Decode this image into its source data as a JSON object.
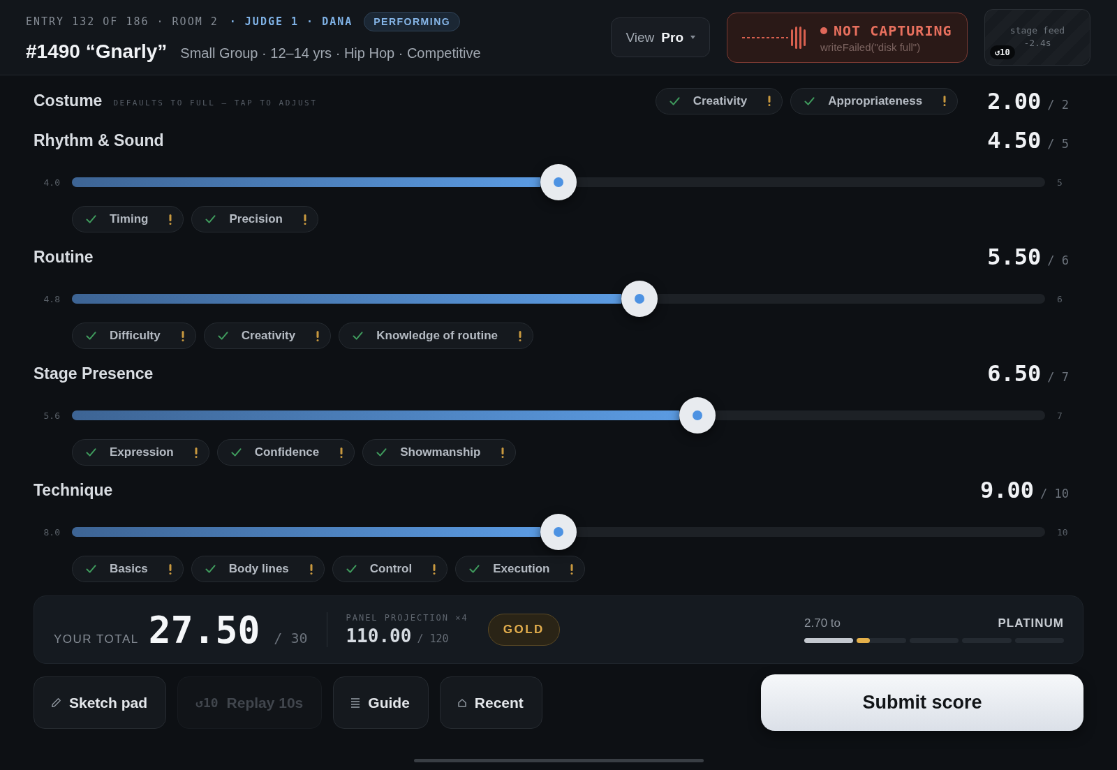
{
  "header": {
    "entry": "ENTRY 132 OF 186 · ROOM 2",
    "judge": "· JUDGE 1 · DANA",
    "status_badge": "PERFORMING",
    "routine_title": "#1490 “Gnarly”",
    "details": "Small Group · 12–14 yrs · Hip Hop · Competitive",
    "view_menu": {
      "label": "View",
      "value": "Pro"
    },
    "capture": {
      "capturing": false,
      "status": "NOT CAPTURING",
      "detail": "writeFailed(\"disk full\")"
    },
    "stage_feed": {
      "label": "stage feed",
      "delay": "-2.4s",
      "replay_badge": "↺10"
    }
  },
  "sections": [
    {
      "kind": "fixed",
      "title": "Costume",
      "hint": "DEFAULTS TO FULL — TAP TO ADJUST",
      "score": "2.00",
      "out_of": "/ 2",
      "criteria": [
        {
          "label": "Creativity",
          "checked": true
        },
        {
          "label": "Appropriateness",
          "checked": true
        }
      ]
    },
    {
      "kind": "slider",
      "title": "Rhythm & Sound",
      "score": "4.50",
      "out_of": "/ 5",
      "slider": {
        "min_label": "4.0",
        "max_label": "5",
        "level": 0.5
      },
      "criteria": [
        {
          "label": "Timing",
          "checked": true
        },
        {
          "label": "Precision",
          "checked": true
        }
      ]
    },
    {
      "kind": "slider",
      "title": "Routine",
      "score": "5.50",
      "out_of": "/ 6",
      "slider": {
        "min_label": "4.8",
        "max_label": "6",
        "level": 0.583
      },
      "criteria": [
        {
          "label": "Difficulty",
          "checked": true
        },
        {
          "label": "Creativity",
          "checked": true
        },
        {
          "label": "Knowledge of routine",
          "checked": true
        }
      ]
    },
    {
      "kind": "slider",
      "title": "Stage Presence",
      "score": "6.50",
      "out_of": "/ 7",
      "slider": {
        "min_label": "5.6",
        "max_label": "7",
        "level": 0.643
      },
      "criteria": [
        {
          "label": "Expression",
          "checked": true
        },
        {
          "label": "Confidence",
          "checked": true
        },
        {
          "label": "Showmanship",
          "checked": true
        }
      ]
    },
    {
      "kind": "slider",
      "title": "Technique",
      "score": "9.00",
      "out_of": "/ 10",
      "slider": {
        "min_label": "8.0",
        "max_label": "10",
        "level": 0.5
      },
      "criteria": [
        {
          "label": "Basics",
          "checked": true
        },
        {
          "label": "Body lines",
          "checked": true
        },
        {
          "label": "Control",
          "checked": true
        },
        {
          "label": "Execution",
          "checked": true
        }
      ]
    }
  ],
  "total": {
    "label": "YOUR TOTAL",
    "value": "27.50",
    "out_of": "/ 30",
    "projection": {
      "label": "PANEL PROJECTION ×4",
      "value": "110.00",
      "out_of": "/ 120"
    },
    "award": "GOLD",
    "next_tier": {
      "gap": "2.70 to",
      "name": "PLATINUM",
      "segments": [
        {
          "reached": true,
          "color": "#c3c8cf"
        },
        {
          "reached": false,
          "level": 0.26,
          "color": "#e4b04a"
        },
        {
          "reached": false
        },
        {
          "reached": false
        },
        {
          "reached": false
        }
      ]
    }
  },
  "actions": [
    {
      "kind": "sketch",
      "label": "Sketch pad",
      "disabled": false
    },
    {
      "kind": "replay",
      "icon_text": "↺10",
      "label": "Replay 10s",
      "disabled": true
    },
    {
      "kind": "guide",
      "label": "Guide",
      "disabled": false
    },
    {
      "kind": "recent",
      "label": "Recent",
      "disabled": false
    }
  ],
  "submit": {
    "label": "Submit score"
  }
}
